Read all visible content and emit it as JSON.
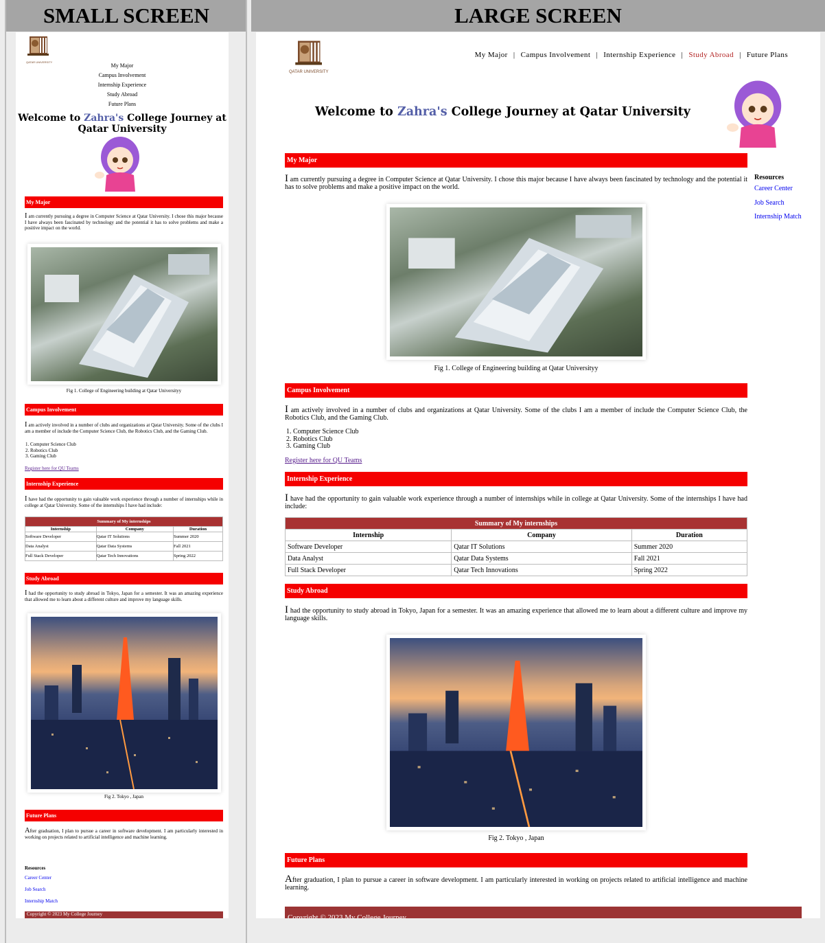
{
  "labels": {
    "small": "SMALL SCREEN",
    "large": "LARGE SCREEN"
  },
  "logo_text": "QATAR UNIVERSITY",
  "nav": [
    "My Major",
    "Campus Involvement",
    "Internship Experience",
    "Study Abroad",
    "Future Plans"
  ],
  "nav_sep": "|",
  "title": {
    "pre": "Welcome to ",
    "name": "Zahra's",
    "post": " College Journey at Qatar University",
    "post_small_1": " College Journey at",
    "post_small_2": "Qatar University"
  },
  "sections": {
    "major": {
      "heading": "My Major",
      "first": "I",
      "text": " am currently pursuing a degree in Computer Science at Qatar University. I chose this major because I have always been fascinated by technology and the potential it has to solve problems and make a positive impact on the world."
    },
    "fig1": "Fig 1. College of Engineering building at Qatar Universityy",
    "campus": {
      "heading": "Campus Involvement",
      "first": "I",
      "text": " am actively involved in a number of clubs and organizations at Qatar University. Some of the clubs I am a member of include the Computer Science Club, the Robotics Club, and the Gaming Club.",
      "list": [
        "Computer Science Club",
        "Robotics Club",
        "Gaming Club"
      ],
      "link": "Register here for QU Teams"
    },
    "internship": {
      "heading": "Internship Experience",
      "first": "I",
      "text": " have had the opportunity to gain valuable work experience through a number of internships while in college at Qatar University. Some of the internships I have had include:"
    },
    "table": {
      "caption": "Summary of My internships",
      "headers": [
        "Internship",
        "Company",
        "Duration"
      ],
      "rows": [
        [
          "Software Developer",
          "Qatar IT Solutions",
          "Summer 2020"
        ],
        [
          "Data Analyst",
          "Qatar Data Systems",
          "Fall 2021"
        ],
        [
          "Full Stack Developer",
          "Qatar Tech Innovations",
          "Spring 2022"
        ]
      ]
    },
    "abroad": {
      "heading": "Study Abroad",
      "first": "I",
      "text": " had the opportunity to study abroad in Tokyo, Japan for a semester. It was an amazing experience that allowed me to learn about a different culture and improve my language skills."
    },
    "fig2": "Fig 2. Tokyo , Japan",
    "future": {
      "heading": "Future Plans",
      "first": "A",
      "text": "fter graduation, I plan to pursue a career in software development. I am particularly interested in working on projects related to artificial intelligence and machine learning."
    }
  },
  "resources": {
    "heading": "Resources",
    "links": [
      "Career Center",
      "Job Search",
      "Internship Match"
    ]
  },
  "footer": "Copyright © 2023 My College Journey",
  "colors": {
    "accent_red": "#f50000",
    "footer_brown": "#9b3434",
    "name_blue": "#5560a8",
    "table_head": "#a83232",
    "active_nav": "#b22222"
  }
}
